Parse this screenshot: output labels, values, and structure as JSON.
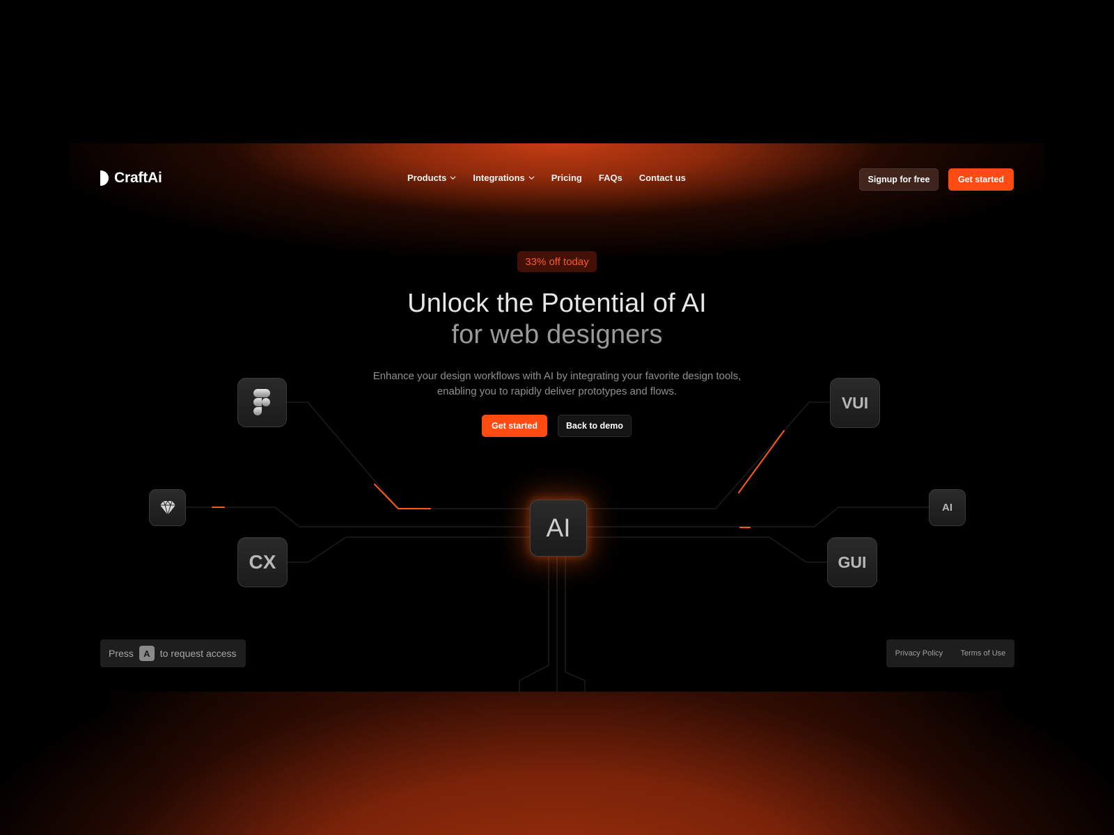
{
  "brand": {
    "name": "CraftAi"
  },
  "nav": {
    "items": [
      {
        "label": "Products",
        "has_dropdown": true
      },
      {
        "label": "Integrations",
        "has_dropdown": true
      },
      {
        "label": "Pricing",
        "has_dropdown": false
      },
      {
        "label": "FAQs",
        "has_dropdown": false
      },
      {
        "label": "Contact us",
        "has_dropdown": false
      }
    ]
  },
  "header": {
    "signup_label": "Signup for free",
    "get_started_label": "Get started"
  },
  "hero": {
    "badge": "33% off today",
    "title_line1": "Unlock the Potential of AI",
    "title_line2": "for web designers",
    "subtitle_line1": "Enhance your design workflows with AI by integrating your favorite design tools,",
    "subtitle_line2": "enabling you to rapidly deliver prototypes and flows.",
    "primary_cta": "Get started",
    "secondary_cta": "Back to demo"
  },
  "integrations": {
    "left": [
      {
        "icon": "figma-icon"
      },
      {
        "icon": "sketch-icon"
      },
      {
        "label": "CX"
      }
    ],
    "center": {
      "label": "AI"
    },
    "right": [
      {
        "label": "VUI"
      },
      {
        "label": "AI"
      },
      {
        "label": "GUI"
      }
    ]
  },
  "footer": {
    "press_prefix": "Press",
    "press_key": "A",
    "press_suffix": "to request access",
    "privacy_label": "Privacy Policy",
    "terms_label": "Terms of Use"
  },
  "colors": {
    "accent": "#ff4a12",
    "background": "#000000",
    "tile": "#1f1f1f"
  }
}
